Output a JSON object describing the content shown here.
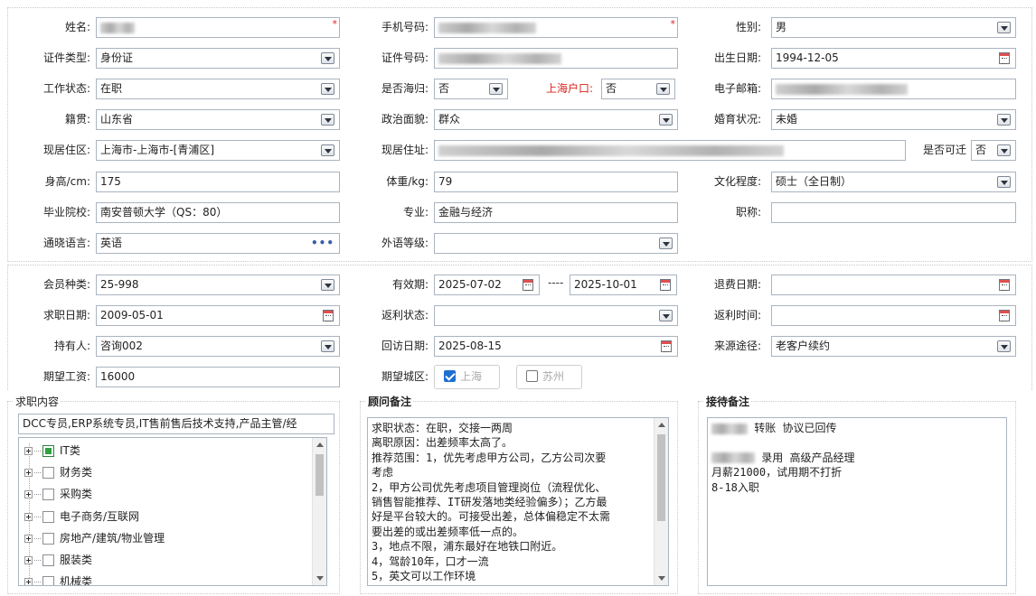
{
  "basic": {
    "name": {
      "label": "姓名:",
      "required_mark": "*"
    },
    "phone": {
      "label": "手机号码:",
      "required_mark": "*"
    },
    "gender": {
      "label": "性别:",
      "value": "男"
    },
    "id_type": {
      "label": "证件类型:",
      "value": "身份证"
    },
    "id_number": {
      "label": "证件号码:"
    },
    "birth_date": {
      "label": "出生日期:",
      "value": "1994-12-05"
    },
    "work_status": {
      "label": "工作状态:",
      "value": "在职"
    },
    "returnee": {
      "label": "是否海归:",
      "value": "否"
    },
    "shanghai_hukou": {
      "label": "上海户口:",
      "value": "否",
      "label_color": "#d9231c"
    },
    "email": {
      "label": "电子邮箱:"
    },
    "native_place": {
      "label": "籍贯:",
      "value": "山东省"
    },
    "political": {
      "label": "政治面貌:",
      "value": "群众"
    },
    "marital": {
      "label": "婚育状况:",
      "value": "未婚"
    },
    "residence_area": {
      "label": "现居住区:",
      "value": "上海市-上海市-[青浦区]"
    },
    "residence_address": {
      "label": "现居住址:"
    },
    "relocate": {
      "label": "是否可迁",
      "value": "否"
    },
    "height": {
      "label": "身高/cm:",
      "value": "175"
    },
    "weight": {
      "label": "体重/kg:",
      "value": "79"
    },
    "education": {
      "label": "文化程度:",
      "value": "硕士（全日制）"
    },
    "school": {
      "label": "毕业院校:",
      "value": "南安普顿大学（QS：80）"
    },
    "major": {
      "label": "专业:",
      "value": "金融与经济"
    },
    "title": {
      "label": "职称:",
      "value": ""
    },
    "languages": {
      "label": "通晓语言:",
      "value": "英语"
    },
    "foreign_level": {
      "label": "外语等级:",
      "value": ""
    }
  },
  "member": {
    "member_type": {
      "label": "会员种类:",
      "value": "25-998"
    },
    "validity": {
      "label": "有效期:",
      "start": "2025-07-02",
      "separator": "----",
      "end": "2025-10-01"
    },
    "refund_date": {
      "label": "退费日期:",
      "value": ""
    },
    "job_date": {
      "label": "求职日期:",
      "value": "2009-05-01"
    },
    "rebate_status": {
      "label": "返利状态:",
      "value": ""
    },
    "rebate_time": {
      "label": "返利时间:",
      "value": ""
    },
    "holder": {
      "label": "持有人:",
      "value": "咨询002"
    },
    "visit_date": {
      "label": "回访日期:",
      "value": "2025-08-15"
    },
    "source": {
      "label": "来源途径:",
      "value": "老客户续约"
    },
    "expected_salary": {
      "label": "期望工资:",
      "value": "16000"
    },
    "expected_city": {
      "label": "期望城区:",
      "options": [
        "上海",
        "苏州"
      ],
      "checked": [
        true,
        false
      ]
    }
  },
  "job_content": {
    "legend": "求职内容",
    "summary": "DCC专员,ERP系统专员,IT售前售后技术支持,产品主管/经",
    "tree": [
      {
        "label": "IT类",
        "checked": true
      },
      {
        "label": "财务类",
        "checked": false
      },
      {
        "label": "采购类",
        "checked": false
      },
      {
        "label": "电子商务/互联网",
        "checked": false
      },
      {
        "label": "房地产/建筑/物业管理",
        "checked": false
      },
      {
        "label": "服装类",
        "checked": false
      },
      {
        "label": "机械类",
        "checked": false
      }
    ]
  },
  "advisor_notes": {
    "legend": "顾问备注",
    "lines": [
      "求职状态：在职，交接一两周",
      "离职原因：出差频率太高了。",
      "推荐范围：1，优先考虑甲方公司，乙方公司次要",
      "考虑",
      "2，甲方公司优先考虑项目管理岗位（流程优化、",
      "销售智能推荐、IT研发落地类经验偏多）；乙方最",
      "好是平台较大的。可接受出差，总体偏稳定不太需",
      "要出差的或出差频率低一点的。",
      "3，地点不限，浦东最好在地铁口附近。",
      "4，驾龄10年，口才一流",
      "5，英文可以工作环境"
    ]
  },
  "reception_notes": {
    "legend": "接待备注",
    "line1": "转账 协议已回传",
    "line2": "录用  高级产品经理",
    "line3": "月薪21000，试用期不打折",
    "line4": "8-18入职"
  }
}
